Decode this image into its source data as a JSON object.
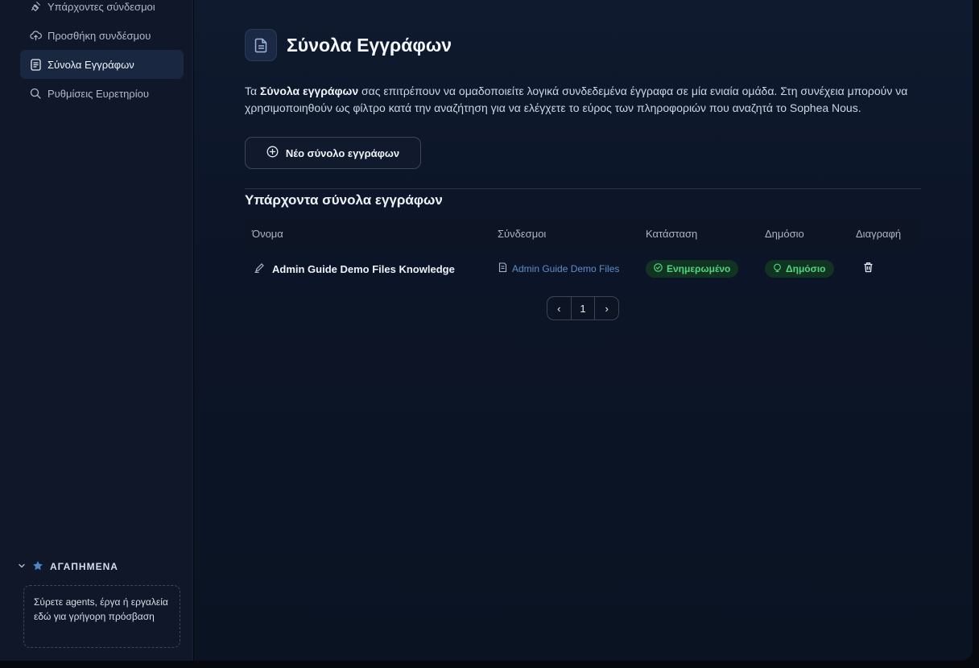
{
  "sidebar": {
    "items": [
      {
        "label": "Υπάρχοντες σύνδεσμοι",
        "icon": "plug-icon",
        "active": false
      },
      {
        "label": "Προσθήκη συνδέσμου",
        "icon": "cloud-upload-icon",
        "active": false
      },
      {
        "label": "Σύνολα Εγγράφων",
        "icon": "document-icon",
        "active": true
      },
      {
        "label": "Ρυθμίσεις Ευρετηρίου",
        "icon": "search-icon",
        "active": false
      }
    ],
    "favorites": {
      "title": "ΑΓΑΠΗΜΕΝΑ",
      "placeholder": "Σύρετε agents, έργα ή εργαλεία εδώ για γρήγορη πρόσβαση"
    }
  },
  "main": {
    "title": "Σύνολα Εγγράφων",
    "description_prefix": "Τα ",
    "description_bold": "Σύνολα εγγράφων",
    "description_rest": " σας επιτρέπουν να ομαδοποιείτε λογικά συνδεδεμένα έγγραφα σε μία ενιαία ομάδα. Στη συνέχεια μπορούν να χρησιμοποιηθούν ως φίλτρο κατά την αναζήτηση για να ελέγχετε το εύρος των πληροφοριών που αναζητά το Sophea Nous.",
    "new_button": "Νέο σύνολο εγγράφων",
    "section_title": "Υπάρχοντα σύνολα εγγράφων",
    "table": {
      "headers": [
        "Όνομα",
        "Σύνδεσμοι",
        "Κατάσταση",
        "Δημόσιο",
        "Διαγραφή"
      ],
      "rows": [
        {
          "name": "Admin Guide Demo Files Knowledge",
          "connector": "Admin Guide Demo Files",
          "status": "Ενημερωμένο",
          "public": "Δημόσιο"
        }
      ]
    },
    "pagination": {
      "prev": "‹",
      "page": "1",
      "next": "›"
    }
  },
  "colors": {
    "accent": "#5b8ec9",
    "success_text": "#4fd67f",
    "success_bg": "#113321",
    "sidebar_bg": "#0f1729"
  }
}
